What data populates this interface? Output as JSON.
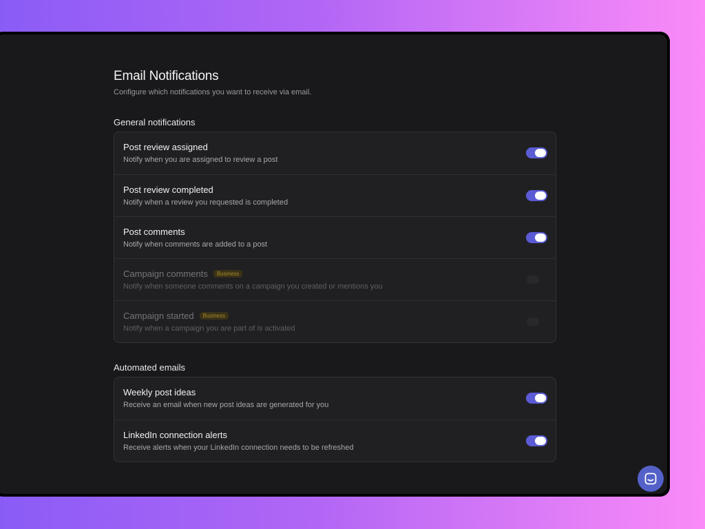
{
  "page": {
    "title": "Email Notifications",
    "subtitle": "Configure which notifications you want to receive via email."
  },
  "general": {
    "title": "General notifications",
    "items": [
      {
        "title": "Post review assigned",
        "description": "Notify when you are assigned to review a post",
        "enabled": true
      },
      {
        "title": "Post review completed",
        "description": "Notify when a review you requested is completed",
        "enabled": true
      },
      {
        "title": "Post comments",
        "description": "Notify when comments are added to a post",
        "enabled": true
      },
      {
        "title": "Campaign comments",
        "badge": "Business",
        "description": "Notify when someone comments on a campaign you created or mentions you",
        "enabled": false,
        "disabled": true
      },
      {
        "title": "Campaign started",
        "badge": "Business",
        "description": "Notify when a campaign you are part of is activated",
        "enabled": false,
        "disabled": true
      }
    ]
  },
  "automated": {
    "title": "Automated emails",
    "items": [
      {
        "title": "Weekly post ideas",
        "description": "Receive an email when new post ideas are generated for you",
        "enabled": true
      },
      {
        "title": "LinkedIn connection alerts",
        "description": "Receive alerts when your LinkedIn connection needs to be refreshed",
        "enabled": true
      }
    ]
  },
  "chat": {
    "icon": "chat-icon"
  },
  "colors": {
    "accent": "#5b5bd6",
    "badge_text": "#a88a2c",
    "background": "#19191b"
  }
}
